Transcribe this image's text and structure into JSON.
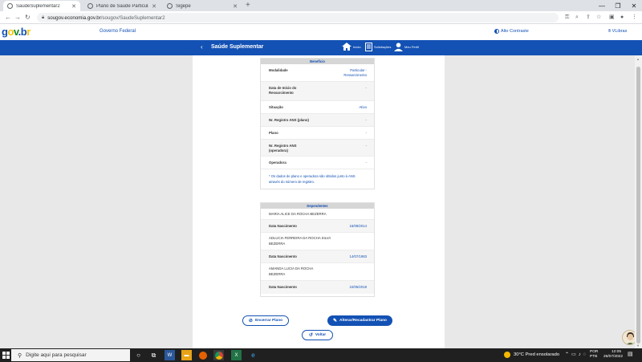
{
  "browser": {
    "tabs": [
      {
        "label": "SaudeSuplementar2"
      },
      {
        "label": "Plano de Saúde Particular - Rem"
      },
      {
        "label": "Sigepe"
      }
    ],
    "url_host": "sougov.economia.gov.br",
    "url_path": "/sougov/SaudeSuplementar2"
  },
  "header": {
    "gov_federal": "Governo Federal",
    "contrast": "Alto Contraste",
    "vlibras": "VLibras"
  },
  "appbar": {
    "title": "Saúde Suplementar",
    "nav": [
      {
        "label": "Início",
        "icon": "home-icon"
      },
      {
        "label": "Solicitações",
        "icon": "document-icon"
      },
      {
        "label": "Meu Perfil",
        "icon": "user-icon"
      }
    ]
  },
  "beneficio": {
    "title": "Benefício",
    "rows": [
      {
        "label": "Modalidade",
        "value": "Particular - Ressarcimento"
      },
      {
        "label": "Data de Início do Ressarcimento",
        "value": "-"
      },
      {
        "label": "Situação",
        "value": "Ativo"
      },
      {
        "label": "Nr. Registro ANS (plano)",
        "value": "-"
      },
      {
        "label": "Plano",
        "value": "-"
      },
      {
        "label": "Nr. Registro ANS (operadora)",
        "value": "-"
      },
      {
        "label": "Operadora",
        "value": "-"
      }
    ],
    "note": "* Os dados de plano e operadora são obtidos junto à ANS através do número de registro."
  },
  "dependentes": {
    "title": "Dependentes",
    "birth_label": "Data Nascimento",
    "items": [
      {
        "name": "MARIA ALICE DA ROCHA BEZERRA",
        "birth": "16/09/2014"
      },
      {
        "name": "ADLUCIA FERREIRA DA ROCHA SILVA BEZERRA",
        "birth": "14/07/1983"
      },
      {
        "name": "AMANDA LUCIA DA ROCHA BEZERRA",
        "birth": "24/05/2018"
      }
    ]
  },
  "actions": {
    "encerrar": "Encerrar Plano",
    "alterar": "Alterar/Recadastrar Plano",
    "voltar": "Voltar"
  },
  "taskbar": {
    "search_placeholder": "Digite aqui para pesquisar",
    "weather": "30°C  Pred ensolarado",
    "lang1": "POR",
    "lang2": "PTB",
    "time": "12:05",
    "date": "26/07/2022"
  }
}
